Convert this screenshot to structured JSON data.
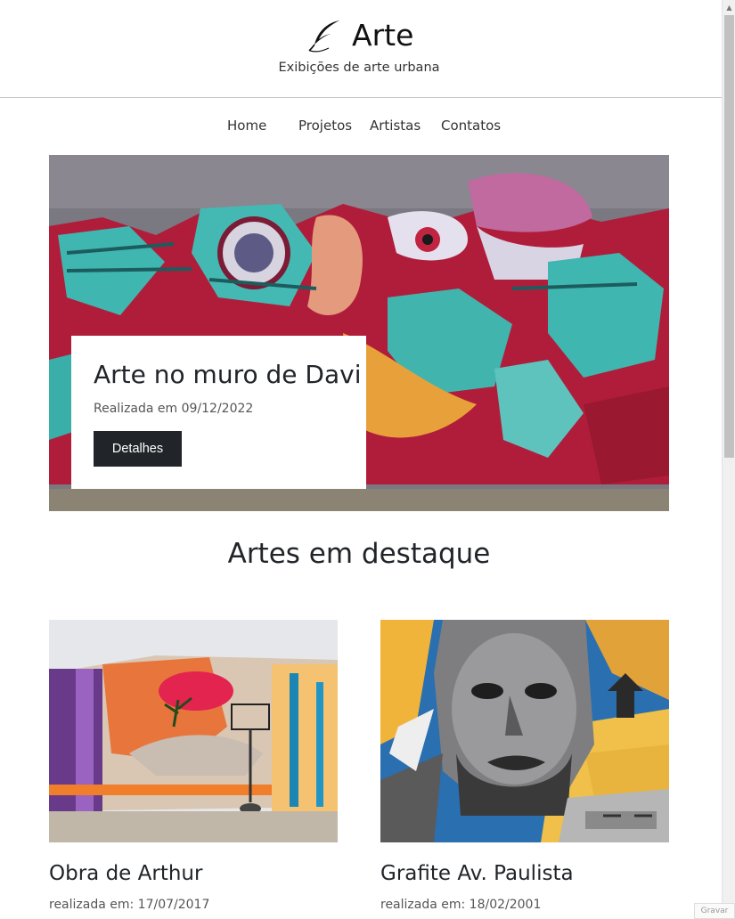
{
  "header": {
    "brand_title": "Arte",
    "tagline": "Exibições de arte urbana",
    "logo_icon": "feather-icon"
  },
  "nav": {
    "items": [
      {
        "label": "Home"
      },
      {
        "label": "Projetos"
      },
      {
        "label": "Artistas"
      },
      {
        "label": "Contatos"
      }
    ]
  },
  "hero": {
    "title": "Arte no muro de Davi",
    "date": "Realizada em 09/12/2022",
    "button_label": "Detalhes"
  },
  "featured": {
    "title": "Artes em destaque",
    "cards": [
      {
        "title": "Obra de Arthur",
        "date": "realizada em: 17/07/2017"
      },
      {
        "title": "Grafite Av. Paulista",
        "date": "realizada em: 18/02/2001"
      }
    ]
  },
  "overlay": {
    "record_label": "Gravar"
  },
  "colors": {
    "dark_button": "#212529",
    "text": "#212529",
    "divider": "#c9c9c9"
  }
}
